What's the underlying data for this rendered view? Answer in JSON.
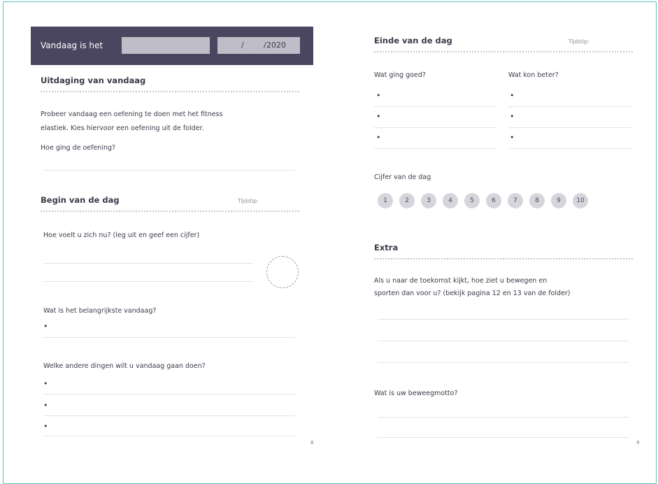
{
  "left": {
    "date_bar": {
      "label": "Vandaag is het",
      "slash1": "/",
      "slash2": "/",
      "year": "2020"
    },
    "challenge": {
      "heading": "Uitdaging van vandaag",
      "line1": "Probeer vandaag een oefening te doen met het fitness",
      "line2": "elastiek. Kies hiervoor een oefening uit de folder.",
      "question": "Hoe ging de oefening?"
    },
    "start": {
      "heading": "Begin van de dag",
      "time_label": "Tijdstip:",
      "feel_q": "Hoe voelt u zich nu? (leg uit en geef een cijfer)",
      "important_q": "Wat is het belangrijkste vandaag?",
      "other_q": "Welke andere dingen wilt u vandaag gaan doen?"
    },
    "page_number": "8"
  },
  "right": {
    "end": {
      "heading": "Einde van de dag",
      "time_label": "Tijdstip:",
      "good_q": "Wat ging goed?",
      "better_q": "Wat kon beter?"
    },
    "score": {
      "label": "Cijfer van de dag",
      "values": [
        "1",
        "2",
        "3",
        "4",
        "5",
        "6",
        "7",
        "8",
        "9",
        "10"
      ]
    },
    "extra": {
      "heading": "Extra",
      "line1": "Als u naar de toekomst kijkt, hoe ziet u bewegen en",
      "line2": "sporten dan voor u? (bekijk pagina 12 en 13 van de folder)",
      "motto_q": "Wat is uw beweegmotto?"
    },
    "page_number": "9"
  },
  "bullet_char": "•"
}
